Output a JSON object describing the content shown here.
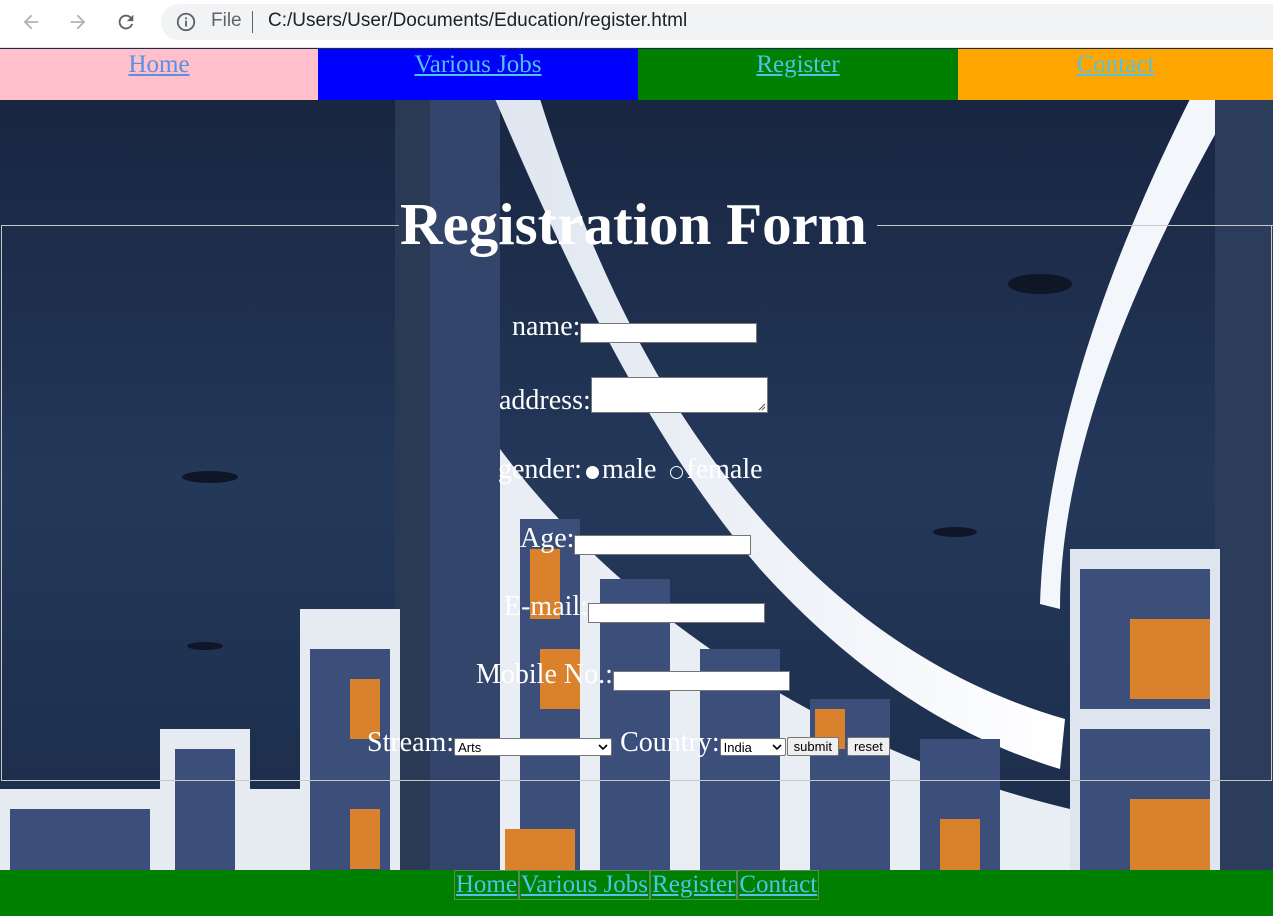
{
  "browser": {
    "url_scheme_label": "File",
    "url": "C:/Users/User/Documents/Education/register.html"
  },
  "nav": {
    "items": [
      {
        "label": "Home",
        "bg": "#ffc0cb",
        "color": "#5b8fe0"
      },
      {
        "label": "Various Jobs",
        "bg": "#0000ff",
        "color": "#4fc3e8"
      },
      {
        "label": "Register",
        "bg": "#008000",
        "color": "#4fc3e8"
      },
      {
        "label": "Contact",
        "bg": "#ffa500",
        "color": "#4fc3e8"
      }
    ]
  },
  "form": {
    "legend": "Registration Form",
    "name_label": "name:",
    "name_value": "",
    "address_label": "address:",
    "address_value": "",
    "gender_label": "gender:",
    "gender_options": [
      "male",
      "female"
    ],
    "gender_selected": "male",
    "age_label": "Age:",
    "age_value": "",
    "email_label": "E-mail:",
    "email_value": "",
    "mobile_label": "Mobile No.:",
    "mobile_value": "",
    "stream_label": "Stream:",
    "stream_selected": "Arts",
    "country_label": "Country:",
    "country_selected": "India",
    "submit_label": "submit",
    "reset_label": "reset"
  },
  "footer": {
    "links": [
      "Home",
      "Various Jobs",
      "Register",
      "Contact"
    ]
  },
  "icons": [
    "back-arrow-icon",
    "forward-arrow-icon",
    "reload-icon",
    "info-icon",
    "chevron-down-icon",
    "resize-grip-icon"
  ]
}
